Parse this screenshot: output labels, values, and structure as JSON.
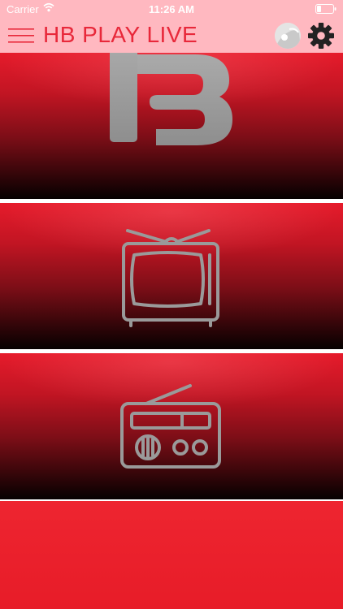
{
  "status_bar": {
    "carrier": "Carrier",
    "time": "11:26 AM",
    "icons": [
      "wifi-icon",
      "battery-icon"
    ]
  },
  "nav_bar": {
    "title": "HB PLAY LIVE",
    "title_color": "#e8283a",
    "background": "#ffb8c0",
    "left_icon": "hamburger-menu-icon",
    "right_icons": [
      "avatar-icon",
      "gear-icon"
    ]
  },
  "tiles": [
    {
      "icon": "hb-logo-icon"
    },
    {
      "icon": "tv-icon"
    },
    {
      "icon": "radio-icon"
    },
    {
      "icon": ""
    }
  ],
  "colors": {
    "accent_red": "#e61b2b",
    "icon_gray": "#9a9a9a"
  }
}
